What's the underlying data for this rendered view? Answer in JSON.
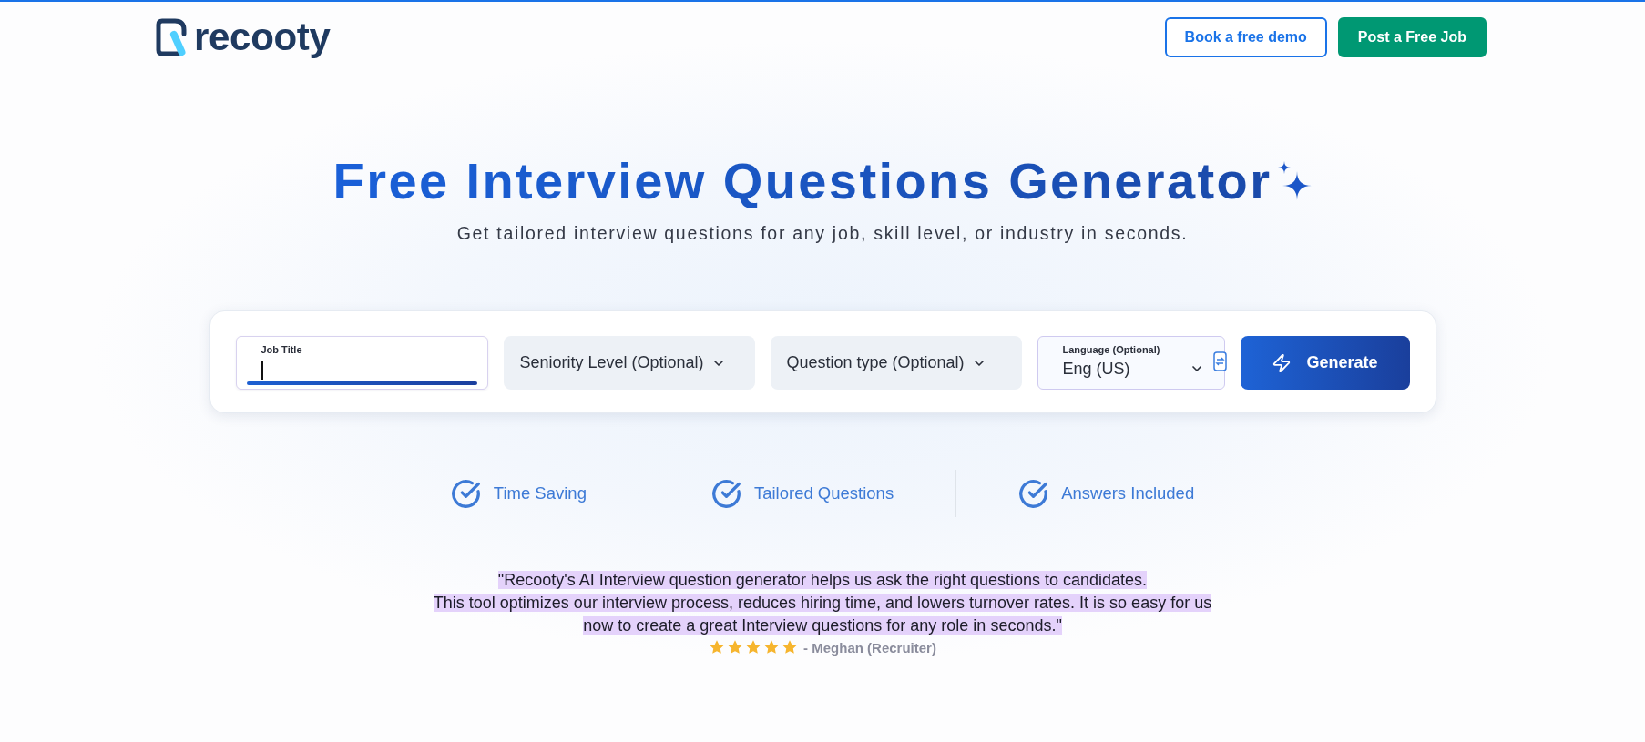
{
  "header": {
    "logo": {
      "text": "recooty"
    },
    "buttons": [
      {
        "label": "Book a free demo",
        "kind": "outline"
      },
      {
        "label": "Post a Free Job",
        "kind": "solid"
      }
    ]
  },
  "hero": {
    "title": "Free Interview Questions Generator",
    "subtitle": "Get tailored interview questions for any job, skill level, or industry in seconds."
  },
  "form": {
    "fields": [
      {
        "kind": "text",
        "label": "Job Title",
        "focused": true
      },
      {
        "kind": "select",
        "value": "Seniority Level (Optional)"
      },
      {
        "kind": "select",
        "value": "Question type (Optional)"
      },
      {
        "kind": "labeled_select",
        "label": "Language (Optional)",
        "value": "Eng (US)"
      }
    ],
    "button": {
      "label": "Generate"
    }
  },
  "features": [
    {
      "label": "Time Saving"
    },
    {
      "label": "Tailored Questions"
    },
    {
      "label": "Answers Included"
    }
  ],
  "testimonial": {
    "quote": "\"Recooty's AI Interview question generator helps us ask the right questions to candidates.\nThis tool optimizes our interview process, reduces hiring time, and lowers turnover rates. It is so easy for us\nnow to create a great Interview questions for any role in seconds.\"",
    "highlighted": true,
    "stars": 5,
    "author": "- Meghan (Recruiter)"
  }
}
